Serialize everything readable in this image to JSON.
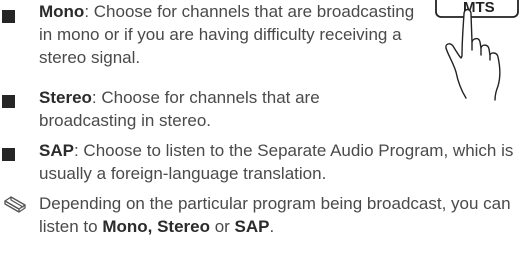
{
  "options": [
    {
      "term": "Mono",
      "description": ": Choose for channels that are broadcasting in mono or if you are having difficulty receiving a stereo signal."
    },
    {
      "term": "Stereo",
      "description": ": Choose for channels that are broadcasting in stereo."
    },
    {
      "term": "SAP",
      "description": ": Choose to listen to the Separate Audio Program, which is usually a foreign-language translation."
    }
  ],
  "note": {
    "icon": "pencil-note-icon",
    "text_before": "Depending on the particular program being broadcast, you can listen to ",
    "mono_stereo": "Mono, Stereo",
    "connector": " or ",
    "sap": "SAP",
    "ending": "."
  },
  "illustration": {
    "button_label": "MTS",
    "icon": "hand-pressing-button-icon"
  },
  "colors": {
    "text": "#4a4a4a",
    "bullet": "#262626"
  }
}
